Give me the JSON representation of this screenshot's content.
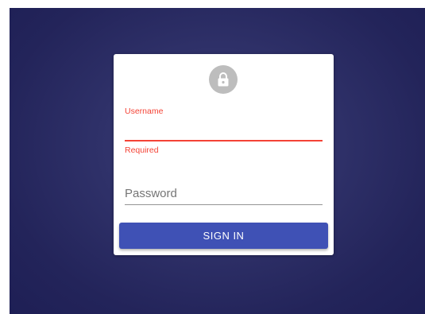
{
  "colors": {
    "background": "#2a2c63",
    "card": "#ffffff",
    "error": "#f44336",
    "primary": "#3f51b5",
    "avatar": "#bdbdbd"
  },
  "login": {
    "icon": "lock-icon",
    "username": {
      "label": "Username",
      "value": "",
      "helper_text": "Required",
      "state": "error"
    },
    "password": {
      "placeholder": "Password",
      "value": ""
    },
    "submit_label": "SIGN IN"
  }
}
